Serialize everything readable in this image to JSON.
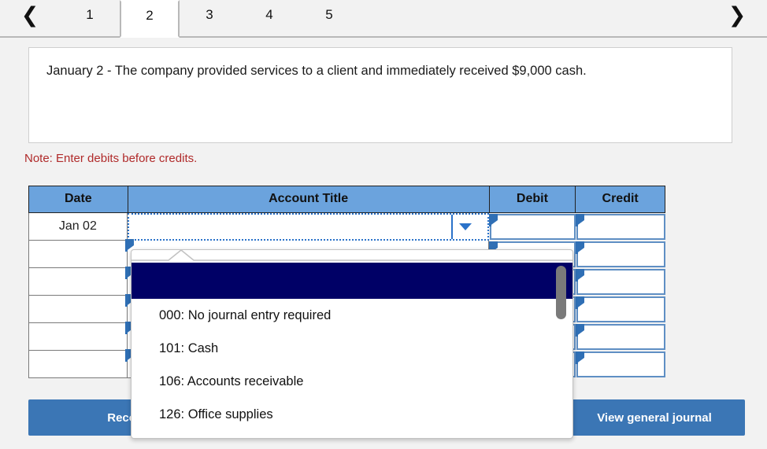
{
  "tabs": {
    "prev_icon": "chevron-left-icon",
    "next_icon": "chevron-right-icon",
    "items": [
      {
        "label": "1",
        "active": false
      },
      {
        "label": "2",
        "active": true
      },
      {
        "label": "3",
        "active": false
      },
      {
        "label": "4",
        "active": false
      },
      {
        "label": "5",
        "active": false
      }
    ]
  },
  "prompt": {
    "text": "January 2 - The company provided services to a client and immediately received $9,000 cash."
  },
  "note": {
    "text": "Note: Enter debits before credits."
  },
  "journal": {
    "headers": {
      "date": "Date",
      "account_title": "Account Title",
      "debit": "Debit",
      "credit": "Credit"
    },
    "rows": [
      {
        "date": "Jan 02",
        "account": "",
        "debit": "",
        "credit": ""
      },
      {
        "date": "",
        "account": "",
        "debit": "",
        "credit": ""
      },
      {
        "date": "",
        "account": "",
        "debit": "",
        "credit": ""
      },
      {
        "date": "",
        "account": "",
        "debit": "",
        "credit": ""
      },
      {
        "date": "",
        "account": "",
        "debit": "",
        "credit": ""
      },
      {
        "date": "",
        "account": "",
        "debit": "",
        "credit": ""
      }
    ]
  },
  "dropdown": {
    "open": true,
    "selected_value": "",
    "options": [
      "",
      "000: No journal entry required",
      "101: Cash",
      "106: Accounts receivable",
      "126: Office supplies"
    ]
  },
  "buttons": {
    "record_entry": "Record entry",
    "view_general_journal": "View general journal"
  },
  "colors": {
    "header_blue": "#6ba3dd",
    "button_blue": "#3b76b5",
    "note_red": "#b02a2a",
    "selection_navy": "#000066",
    "cell_border_blue": "#5f8fc4",
    "focus_dotted_blue": "#2a72c9"
  }
}
